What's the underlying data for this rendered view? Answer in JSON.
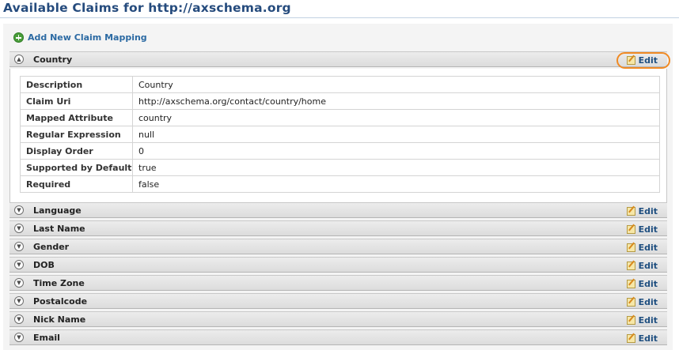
{
  "header": {
    "title": "Available Claims for http://axschema.org"
  },
  "actions": {
    "add_label": "Add New Claim Mapping"
  },
  "claims": [
    {
      "name": "Country",
      "expanded": true,
      "edit_label": "Edit"
    },
    {
      "name": "Language",
      "expanded": false,
      "edit_label": "Edit"
    },
    {
      "name": "Last Name",
      "expanded": false,
      "edit_label": "Edit"
    },
    {
      "name": "Gender",
      "expanded": false,
      "edit_label": "Edit"
    },
    {
      "name": "DOB",
      "expanded": false,
      "edit_label": "Edit"
    },
    {
      "name": "Time Zone",
      "expanded": false,
      "edit_label": "Edit"
    },
    {
      "name": "Postalcode",
      "expanded": false,
      "edit_label": "Edit"
    },
    {
      "name": "Nick Name",
      "expanded": false,
      "edit_label": "Edit"
    },
    {
      "name": "Email",
      "expanded": false,
      "edit_label": "Edit"
    }
  ],
  "details": [
    {
      "label": "Description",
      "value": "Country"
    },
    {
      "label": "Claim Uri",
      "value": "http://axschema.org/contact/country/home"
    },
    {
      "label": "Mapped Attribute",
      "value": "country"
    },
    {
      "label": "Regular Expression",
      "value": "null"
    },
    {
      "label": "Display Order",
      "value": "0"
    },
    {
      "label": "Supported by Default",
      "value": "true"
    },
    {
      "label": "Required",
      "value": "false"
    }
  ],
  "icons": {
    "add": "add-circle-icon",
    "expand": "chevron-down-circle-icon",
    "collapse": "chevron-up-circle-icon",
    "edit": "edit-pencil-icon"
  },
  "colors": {
    "title": "#254b7d",
    "link": "#2c6aa3",
    "highlight": "#f08a24"
  }
}
